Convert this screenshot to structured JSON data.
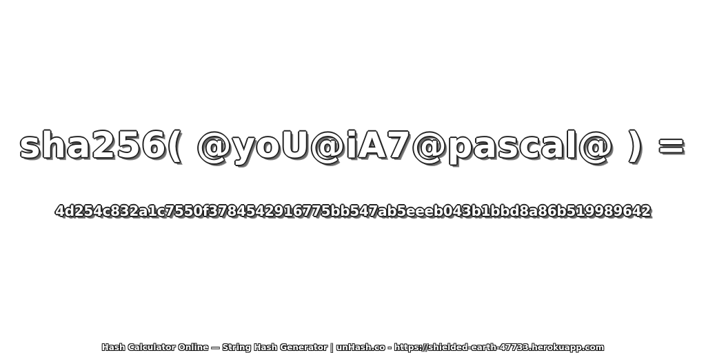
{
  "expression": "sha256( @yoU@iA7@pascal@ ) =",
  "hash": "4d254c832a1c7550f3784542916775bb547ab5eeeb043b1bbd8a86b519989642",
  "footer": "Hash Calculator Online — String Hash Generator | unHash.co - https://shielded-earth-47733.herokuapp.com",
  "colors": {
    "background": "#ffffff",
    "text_fill": "#ffffff",
    "outline": "#222222"
  }
}
